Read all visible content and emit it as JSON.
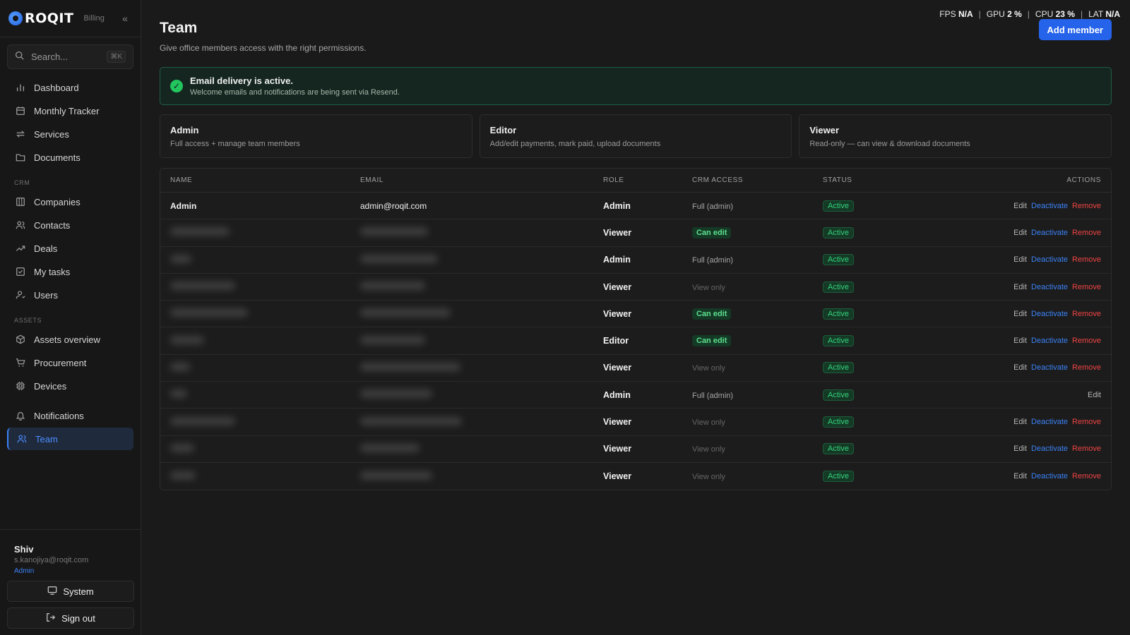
{
  "brand": {
    "name": "ROQIT",
    "section": "Billing"
  },
  "search": {
    "placeholder": "Search...",
    "shortcut": "⌘K"
  },
  "nav_main": [
    {
      "label": "Dashboard",
      "icon": "bar-chart-icon"
    },
    {
      "label": "Monthly Tracker",
      "icon": "calendar-icon"
    },
    {
      "label": "Services",
      "icon": "repeat-icon"
    },
    {
      "label": "Documents",
      "icon": "folder-icon"
    }
  ],
  "crm_label": "CRM",
  "nav_crm": [
    {
      "label": "Companies",
      "icon": "building-icon"
    },
    {
      "label": "Contacts",
      "icon": "users-icon"
    },
    {
      "label": "Deals",
      "icon": "trending-up-icon"
    },
    {
      "label": "My tasks",
      "icon": "checkbox-icon"
    },
    {
      "label": "Users",
      "icon": "user-icon"
    }
  ],
  "assets_label": "ASSETS",
  "nav_assets": [
    {
      "label": "Assets overview",
      "icon": "cube-icon"
    },
    {
      "label": "Procurement",
      "icon": "cart-icon"
    },
    {
      "label": "Devices",
      "icon": "chip-icon"
    }
  ],
  "nav_bottom": [
    {
      "label": "Notifications",
      "icon": "bell-icon"
    },
    {
      "label": "Team",
      "icon": "team-icon",
      "active": true
    }
  ],
  "user": {
    "name": "Shiv",
    "email": "s.kanojiya@roqit.com",
    "role": "Admin"
  },
  "sidebar_buttons": {
    "system": "System",
    "sign_out": "Sign out"
  },
  "perf": {
    "fps_label": "FPS",
    "fps": "N/A",
    "gpu_label": "GPU",
    "gpu": "2 %",
    "cpu_label": "CPU",
    "cpu": "23 %",
    "lat_label": "LAT",
    "lat": "N/A"
  },
  "page": {
    "title": "Team",
    "subtitle": "Give office members access with the right permissions.",
    "add_button": "Add member"
  },
  "alert": {
    "title": "Email delivery is active.",
    "text": "Welcome emails and notifications are being sent via Resend."
  },
  "role_cards": [
    {
      "title": "Admin",
      "desc": "Full access + manage team members"
    },
    {
      "title": "Editor",
      "desc": "Add/edit payments, mark paid, upload documents"
    },
    {
      "title": "Viewer",
      "desc": "Read-only — can view & download documents"
    }
  ],
  "table": {
    "headers": [
      "NAME",
      "EMAIL",
      "ROLE",
      "CRM ACCESS",
      "STATUS",
      "ACTIONS"
    ],
    "actions": {
      "edit": "Edit",
      "deactivate": "Deactivate",
      "remove": "Remove"
    },
    "rows": [
      {
        "name": "Admin",
        "email": "admin@roqit.com",
        "role": "Admin",
        "access": "Full (admin)",
        "access_type": "full",
        "status": "Active",
        "full_actions": true
      },
      {
        "name": "",
        "email": "",
        "role": "Viewer",
        "access": "Can edit",
        "access_type": "edit",
        "status": "Active",
        "full_actions": true
      },
      {
        "name": "",
        "email": "",
        "role": "Admin",
        "access": "Full (admin)",
        "access_type": "full",
        "status": "Active",
        "full_actions": true
      },
      {
        "name": "",
        "email": "",
        "role": "Viewer",
        "access": "View only",
        "access_type": "view",
        "status": "Active",
        "full_actions": true
      },
      {
        "name": "",
        "email": "",
        "role": "Viewer",
        "access": "Can edit",
        "access_type": "edit",
        "status": "Active",
        "full_actions": true
      },
      {
        "name": "",
        "email": "",
        "role": "Editor",
        "access": "Can edit",
        "access_type": "edit",
        "status": "Active",
        "full_actions": true
      },
      {
        "name": "",
        "email": "",
        "role": "Viewer",
        "access": "View only",
        "access_type": "view",
        "status": "Active",
        "full_actions": true
      },
      {
        "name": "",
        "email": "",
        "role": "Admin",
        "access": "Full (admin)",
        "access_type": "full",
        "status": "Active",
        "full_actions": false
      },
      {
        "name": "",
        "email": "",
        "role": "Viewer",
        "access": "View only",
        "access_type": "view",
        "status": "Active",
        "full_actions": true
      },
      {
        "name": "",
        "email": "",
        "role": "Viewer",
        "access": "View only",
        "access_type": "view",
        "status": "Active",
        "full_actions": true
      },
      {
        "name": "",
        "email": "",
        "role": "Viewer",
        "access": "View only",
        "access_type": "view",
        "status": "Active",
        "full_actions": true
      }
    ]
  }
}
